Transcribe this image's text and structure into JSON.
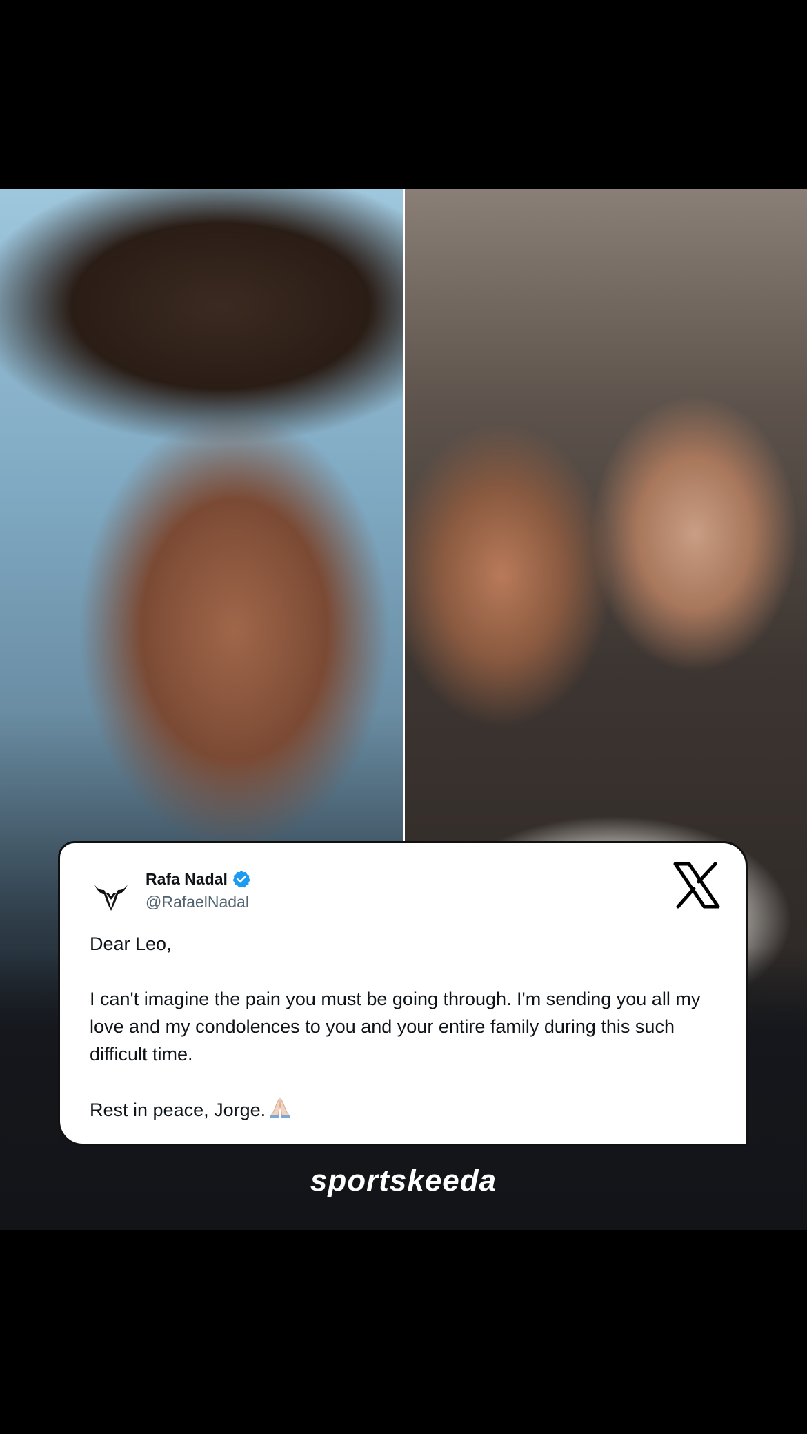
{
  "tweet": {
    "name": "Rafa Nadal",
    "handle": "@RafaelNadal",
    "paragraphs": [
      "Dear Leo,",
      "I can't imagine the pain you must be going through. I'm sending you all my love and my condolences to you and your entire family during this such difficult time.",
      "Rest in peace, Jorge."
    ],
    "verified": true,
    "emoji": "praying-hands-icon"
  },
  "photos": {
    "left": "portrait-photo",
    "right": "selfie-photo"
  },
  "brand": {
    "name": "sportskeeda"
  },
  "colors": {
    "verified_blue": "#1d9bf0",
    "card_bg": "#ffffff",
    "text": "#0f1419",
    "handle": "#536471",
    "background": "#000000"
  }
}
